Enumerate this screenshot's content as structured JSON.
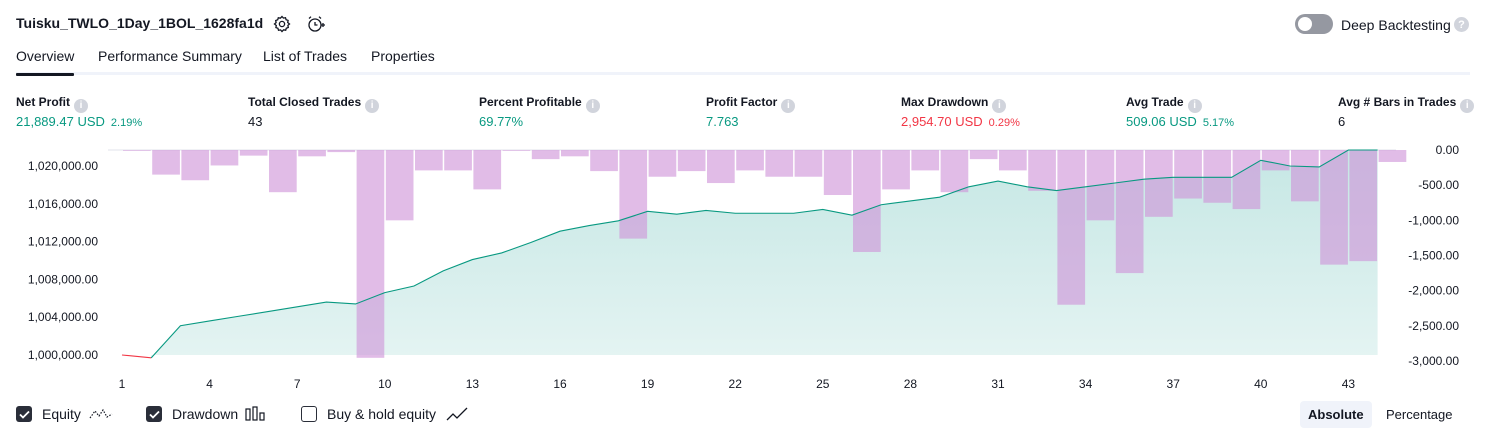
{
  "header": {
    "title": "Tuisku_TWLO_1Day_1BOL_1628fa1d",
    "deep_backtesting_label": "Deep Backtesting",
    "help_glyph": "?",
    "deep_backtesting_enabled": false
  },
  "tabs": [
    {
      "label": "Overview",
      "active": true
    },
    {
      "label": "Performance Summary",
      "active": false
    },
    {
      "label": "List of Trades",
      "active": false
    },
    {
      "label": "Properties",
      "active": false
    }
  ],
  "metrics": [
    {
      "label": "Net Profit",
      "value": "21,889.47 USD",
      "pct": "2.19%",
      "color": "#089981"
    },
    {
      "label": "Total Closed Trades",
      "value": "43",
      "pct": "",
      "color": "#131722"
    },
    {
      "label": "Percent Profitable",
      "value": "69.77%",
      "pct": "",
      "color": "#089981"
    },
    {
      "label": "Profit Factor",
      "value": "7.763",
      "pct": "",
      "color": "#089981"
    },
    {
      "label": "Max Drawdown",
      "value": "2,954.70 USD",
      "pct": "0.29%",
      "color": "#f23645"
    },
    {
      "label": "Avg Trade",
      "value": "509.06 USD",
      "pct": "5.17%",
      "color": "#089981"
    },
    {
      "label": "Avg # Bars in Trades",
      "value": "6",
      "pct": "",
      "color": "#131722"
    }
  ],
  "chart_data": {
    "type": "line",
    "left_axis": {
      "ylim": [
        998500,
        1021500
      ],
      "ticks": [
        1000000,
        1004000,
        1008000,
        1012000,
        1016000,
        1020000
      ],
      "tick_labels": [
        "1,000,000.00",
        "1,004,000.00",
        "1,008,000.00",
        "1,012,000.00",
        "1,016,000.00",
        "1,020,000.00"
      ]
    },
    "right_axis": {
      "ylim": [
        -3000,
        0
      ],
      "ticks": [
        0,
        -500,
        -1000,
        -1500,
        -2000,
        -2500,
        -3000
      ],
      "tick_labels": [
        "0.00",
        "-500.00",
        "-1,000.00",
        "-1,500.00",
        "-2,000.00",
        "-2,500.00",
        "-3,000.00"
      ]
    },
    "x_ticks": [
      1,
      4,
      7,
      10,
      13,
      16,
      19,
      22,
      25,
      28,
      31,
      34,
      37,
      40,
      43
    ],
    "series": [
      {
        "name": "Equity",
        "type": "area",
        "color": "#089981",
        "x": [
          1,
          2,
          3,
          4,
          5,
          6,
          7,
          8,
          9,
          10,
          11,
          12,
          13,
          14,
          15,
          16,
          17,
          18,
          19,
          20,
          21,
          22,
          23,
          24,
          25,
          26,
          27,
          28,
          29,
          30,
          31,
          32,
          33,
          34,
          35,
          36,
          37,
          38,
          39,
          40,
          41,
          42,
          43,
          44
        ],
        "values": [
          1000000,
          999700,
          1003100,
          1003600,
          1004100,
          1004600,
          1005100,
          1005600,
          1005400,
          1006600,
          1007300,
          1008900,
          1010100,
          1010800,
          1011900,
          1013100,
          1013700,
          1014200,
          1015200,
          1014900,
          1015300,
          1015000,
          1015000,
          1015000,
          1015400,
          1014800,
          1015900,
          1016300,
          1016700,
          1017800,
          1018400,
          1017800,
          1017400,
          1017800,
          1018200,
          1018600,
          1018800,
          1018800,
          1018800,
          1020600,
          1020000,
          1019900,
          1022500,
          1022700
        ],
        "color_after_x": 26,
        "color_after": "#089981"
      },
      {
        "name": "Drawdown",
        "type": "bar",
        "color": "#ce93d8",
        "x": [
          1,
          2,
          3,
          4,
          5,
          6,
          7,
          8,
          9,
          10,
          11,
          12,
          13,
          14,
          15,
          16,
          17,
          18,
          19,
          20,
          21,
          22,
          23,
          24,
          25,
          26,
          27,
          28,
          29,
          30,
          31,
          32,
          33,
          34,
          35,
          36,
          37,
          38,
          39,
          40,
          41,
          42,
          43,
          44
        ],
        "values": [
          0,
          -350,
          -430,
          -220,
          -80,
          -600,
          -90,
          -30,
          -2954.7,
          -1000,
          -290,
          -290,
          -560,
          0,
          -130,
          -90,
          -300,
          -1260,
          -380,
          -300,
          -470,
          -290,
          -380,
          -380,
          -640,
          -1450,
          -560,
          -290,
          -600,
          -130,
          -290,
          -580,
          -2200,
          -1000,
          -1750,
          -950,
          -690,
          -750,
          -840,
          -290,
          -730,
          -1630,
          -1580,
          -170
        ]
      }
    ],
    "legend": [
      {
        "name": "Equity",
        "checked": true
      },
      {
        "name": "Drawdown",
        "checked": true
      },
      {
        "name": "Buy & hold equity",
        "checked": false
      }
    ]
  },
  "footer": {
    "absolute_label": "Absolute",
    "percentage_label": "Percentage",
    "absolute_active": true
  }
}
